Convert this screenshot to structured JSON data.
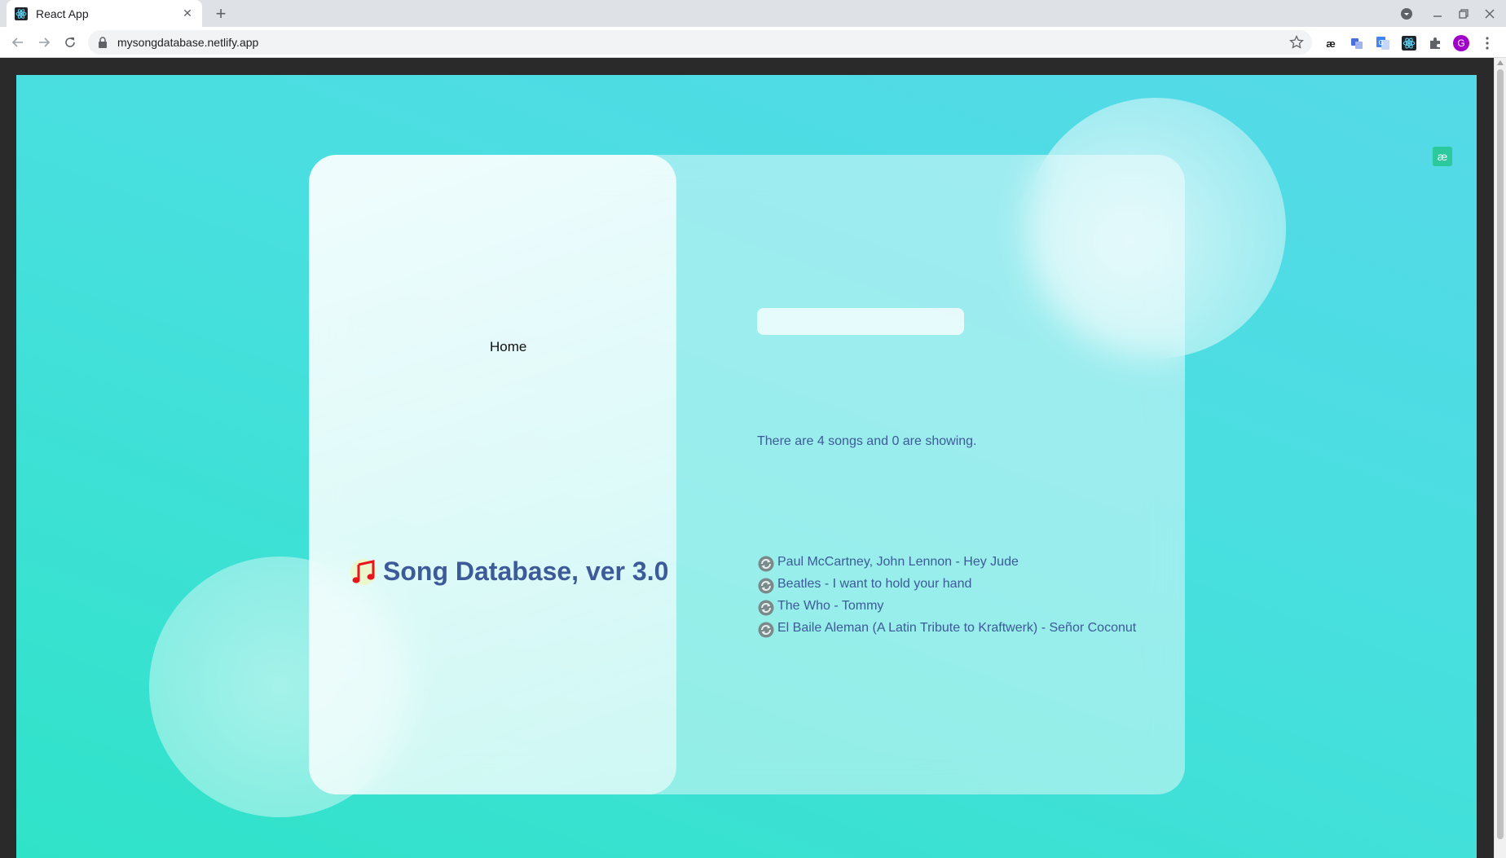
{
  "browser": {
    "tab_title": "React App",
    "tab_close": "✕",
    "new_tab": "+",
    "url": "mysongdatabase.netlify.app",
    "profile_initial": "G",
    "extensions": [
      "ae-extension-icon",
      "translate-icon",
      "google-translate-icon",
      "react-devtools-icon",
      "puzzle-icon"
    ],
    "profile_color": "#a100c9"
  },
  "nav": {
    "home_label": "Home"
  },
  "app": {
    "title": "Song Database, ver 3.0",
    "title_icon": "music-note-icon",
    "title_color": "#3d5a99",
    "search": {
      "value": "",
      "placeholder": ""
    },
    "status": "There are 4 songs and 0 are showing.",
    "songs": [
      {
        "label": "Paul McCartney, John Lennon - Hey Jude",
        "icon": "refresh-icon"
      },
      {
        "label": "Beatles - I want to hold your hand",
        "icon": "refresh-icon"
      },
      {
        "label": "The Who - Tommy",
        "icon": "refresh-icon"
      },
      {
        "label": "El Baile Aleman (A Latin Tribute to Kraftwerk) - Señor Coconut",
        "icon": "refresh-icon"
      }
    ]
  },
  "colors": {
    "background_start": "#2fe3c8",
    "background_end": "#55d9e8",
    "note_icon": "#e8141e",
    "ext_badge": "#2bc99b"
  }
}
